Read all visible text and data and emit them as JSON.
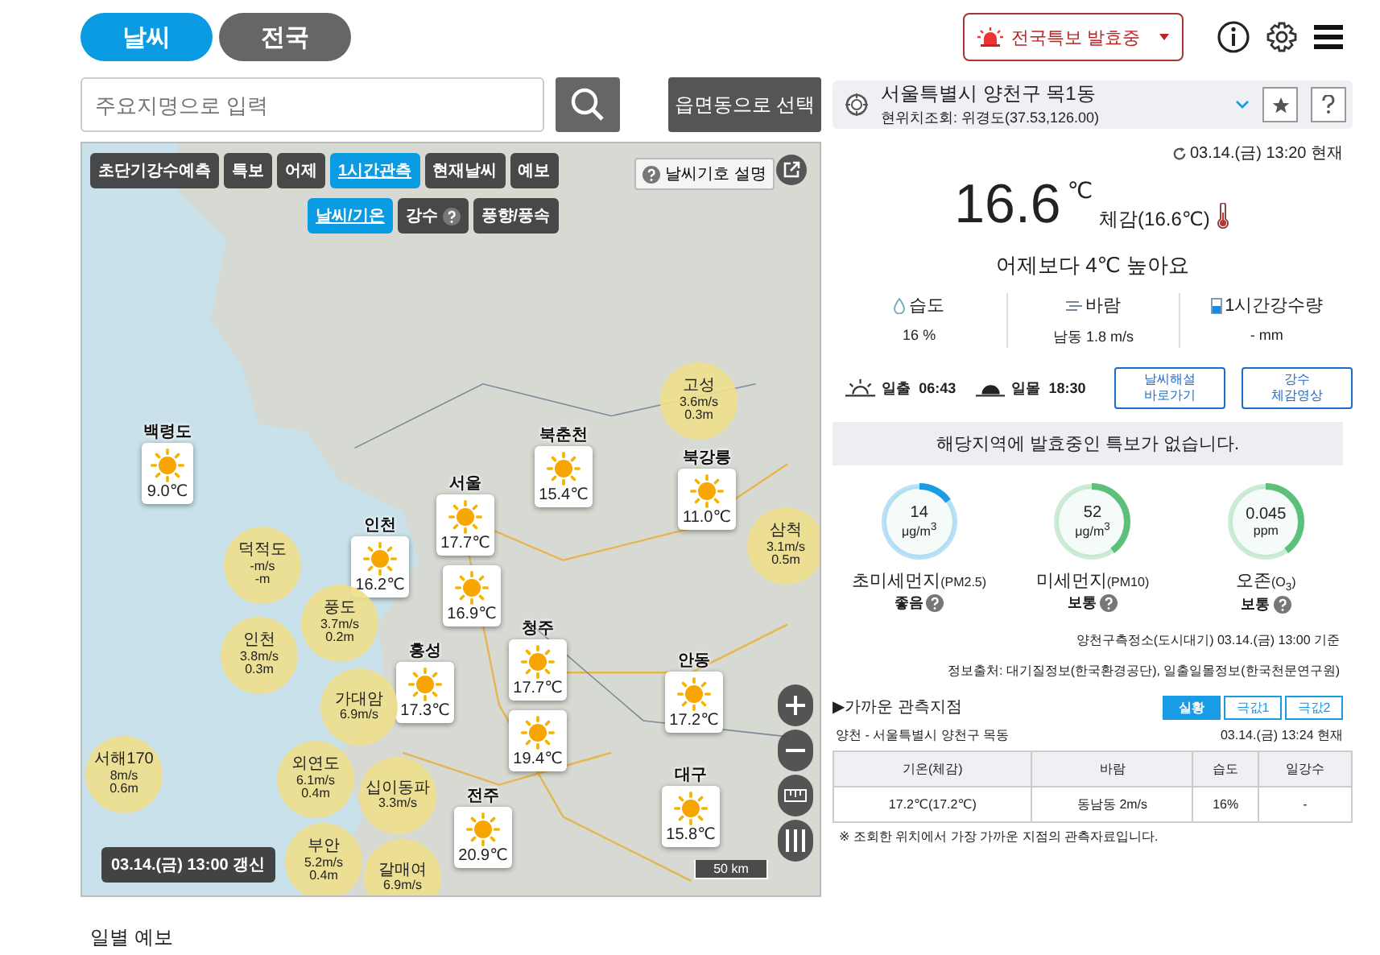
{
  "top_tabs": [
    {
      "label": "날씨",
      "selected": true
    },
    {
      "label": "전국",
      "selected": false
    }
  ],
  "search": {
    "placeholder": "주요지명으로 입력"
  },
  "region_select_button": "읍면동으로 선택",
  "map": {
    "layer_tabs": [
      {
        "label": "초단기강수예측",
        "selected": false
      },
      {
        "label": "특보",
        "selected": false
      },
      {
        "label": "어제",
        "selected": false
      },
      {
        "label": "1시간관측",
        "selected": true
      },
      {
        "label": "현재날씨",
        "selected": false
      },
      {
        "label": "예보",
        "selected": false
      }
    ],
    "sub_tabs": [
      {
        "label": "날씨/기온",
        "selected": true,
        "help": false
      },
      {
        "label": "강수",
        "selected": false,
        "help": true
      },
      {
        "label": "풍향/풍속",
        "selected": false,
        "help": false
      }
    ],
    "legend_button": "날씨기호 설명",
    "stations": [
      {
        "name": "백령도",
        "temp": "9.0℃"
      },
      {
        "name": "북춘천",
        "temp": "15.4℃"
      },
      {
        "name": "북강릉",
        "temp": "11.0℃"
      },
      {
        "name": "서울",
        "temp": "17.7℃"
      },
      {
        "name": "인천",
        "temp": "16.2℃"
      },
      {
        "temp": "16.9℃"
      },
      {
        "name": "홍성",
        "temp": "17.3℃"
      },
      {
        "name": "청주",
        "temp": "17.7℃"
      },
      {
        "temp": "19.4℃"
      },
      {
        "name": "안동",
        "temp": "17.2℃"
      },
      {
        "name": "전주",
        "temp": "20.9℃"
      },
      {
        "name": "대구",
        "temp": "15.8℃"
      }
    ],
    "buoys": [
      {
        "name": "고성",
        "wind": "3.6m/s",
        "wave": "0.3m"
      },
      {
        "name": "삼척",
        "wind": "3.1m/s",
        "wave": "0.5m"
      },
      {
        "name": "덕적도",
        "wind": "-m/s",
        "wave": "-m"
      },
      {
        "name": "인천",
        "wind": "3.8m/s",
        "wave": "0.3m"
      },
      {
        "name": "풍도",
        "wind": "3.7m/s",
        "wave": "0.2m"
      },
      {
        "name": "가대암",
        "wind": "6.9m/s"
      },
      {
        "name": "서해170",
        "wind": "8m/s",
        "wave": "0.6m"
      },
      {
        "name": "외연도",
        "wind": "6.1m/s",
        "wave": "0.4m"
      },
      {
        "name": "십이동파",
        "wind": "3.3m/s"
      },
      {
        "name": "부안",
        "wind": "5.2m/s",
        "wave": "0.4m"
      },
      {
        "name": "갈매여",
        "wind": "6.9m/s"
      }
    ],
    "scale": "50 km",
    "updated": "03.14.(금) 13:00 갱신"
  },
  "daily_forecast_title": "일별 예보",
  "alert_button": "전국특보 발효중",
  "location": {
    "name": "서울특별시 양천구 목1동",
    "coords": "현위치조회: 위경도(37.53,126.00)"
  },
  "observed_time": "03.14.(금) 13:20 현재",
  "current": {
    "temp": "16.6",
    "unit": "℃",
    "feels": "체감(16.6℃)",
    "compare": "어제보다 4℃ 높아요"
  },
  "stats": [
    {
      "kind": "humidity",
      "label": "습도",
      "value": "16",
      "unit": "%"
    },
    {
      "kind": "wind",
      "label": "바람",
      "value": "남동 1.8",
      "unit": "m/s"
    },
    {
      "kind": "rain",
      "label": "1시간강수량",
      "value": "-",
      "unit": "mm"
    }
  ],
  "sun": [
    {
      "kind": "sunrise",
      "label": "일출",
      "time": "06:43"
    },
    {
      "kind": "sunset",
      "label": "일몰",
      "time": "18:30"
    }
  ],
  "link_buttons": [
    {
      "lines": [
        "날씨해설",
        "바로가기"
      ]
    },
    {
      "lines": [
        "강수",
        "체감영상"
      ]
    }
  ],
  "notice": "해당지역에 발효중인 특보가 없습니다.",
  "air": [
    {
      "value": "14",
      "unit": "μg/m$^{3}$",
      "name": "초미세먼지",
      "sub": "(PM2.5)",
      "grade": "좋음",
      "level": 0.15,
      "color": "#1a9be6"
    },
    {
      "value": "52",
      "unit": "μg/m$^{3}$",
      "name": "미세먼지",
      "sub": "(PM10)",
      "grade": "보통",
      "level": 0.4,
      "color": "#5cc07a"
    },
    {
      "value": "0.045",
      "unit": "ppm",
      "name": "오존",
      "sub": "(O$_{3}$)",
      "grade": "보통",
      "level": 0.4,
      "color": "#5cc07a"
    }
  ],
  "air_station": "양천구측정소(도시대기) 03.14.(금) 13:00 기준",
  "source": "정보출처: 대기질정보(한국환경공단), 일출일몰정보(한국천문연구원)",
  "nearby": {
    "title": "▶가까운 관측지점",
    "tabs": [
      {
        "label": "실황",
        "selected": true
      },
      {
        "label": "극값1",
        "selected": false
      },
      {
        "label": "극값2",
        "selected": false
      }
    ],
    "station": "양천 - 서울특별시 양천구 목동",
    "time": "03.14.(금) 13:24 현재",
    "columns": [
      "기온(체감)",
      "바람",
      "습도",
      "일강수"
    ],
    "rows": [
      [
        "17.2℃(17.2℃)",
        "동남동 2m/s",
        "16%",
        "-"
      ]
    ],
    "note": "※ 조회한 위치에서 가장 가까운 지점의 관측자료입니다."
  }
}
